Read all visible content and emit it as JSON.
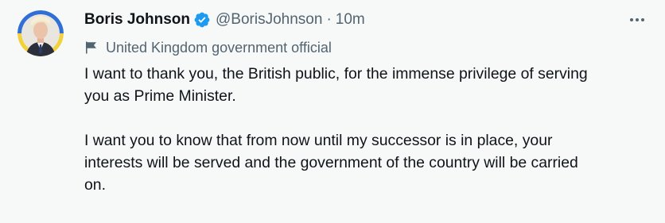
{
  "author": {
    "display_name": "Boris Johnson",
    "handle": "@BorisJohnson",
    "separator": "·",
    "time": "10m",
    "verified": true
  },
  "label": {
    "icon": "flag-icon",
    "text": "United Kingdom government official"
  },
  "tweet": {
    "paragraphs": [
      "I want to thank you, the British public, for the immense privilege of serving\nyou as Prime Minister.",
      "I want you to know that from now until my successor is in place, your\ninterests will be served and the government of the country will be carried\non."
    ]
  },
  "icons": {
    "verified": "verified-badge-icon",
    "more": "more-options-icon"
  },
  "colors": {
    "background": "#f7f9f9",
    "text": "#0f1419",
    "muted": "#536471",
    "verified_blue": "#1d9bf0",
    "avatar_ring_blue": "#2f6fd6",
    "avatar_ring_yellow": "#f2d23c"
  }
}
